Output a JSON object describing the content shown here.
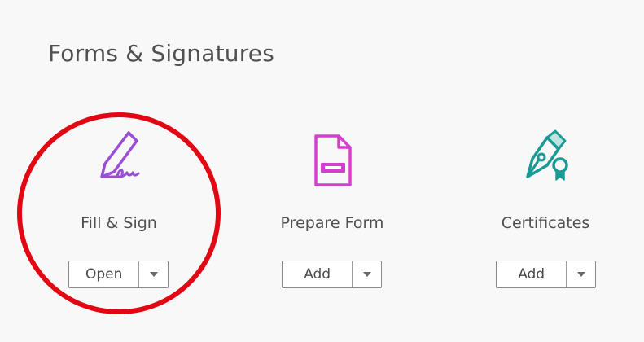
{
  "section": {
    "title": "Forms & Signatures"
  },
  "tools": [
    {
      "label": "Fill & Sign",
      "icon": "fill-sign-pen-icon",
      "button_label": "Open",
      "accent_color": "#9b4fd6"
    },
    {
      "label": "Prepare Form",
      "icon": "prepare-form-document-icon",
      "button_label": "Add",
      "accent_color": "#d53fd0"
    },
    {
      "label": "Certificates",
      "icon": "certificate-pen-ribbon-icon",
      "button_label": "Add",
      "accent_color": "#1b9a94"
    }
  ],
  "annotation": {
    "highlight_color": "#e30613"
  },
  "menu_icon": "chevron-down-icon"
}
